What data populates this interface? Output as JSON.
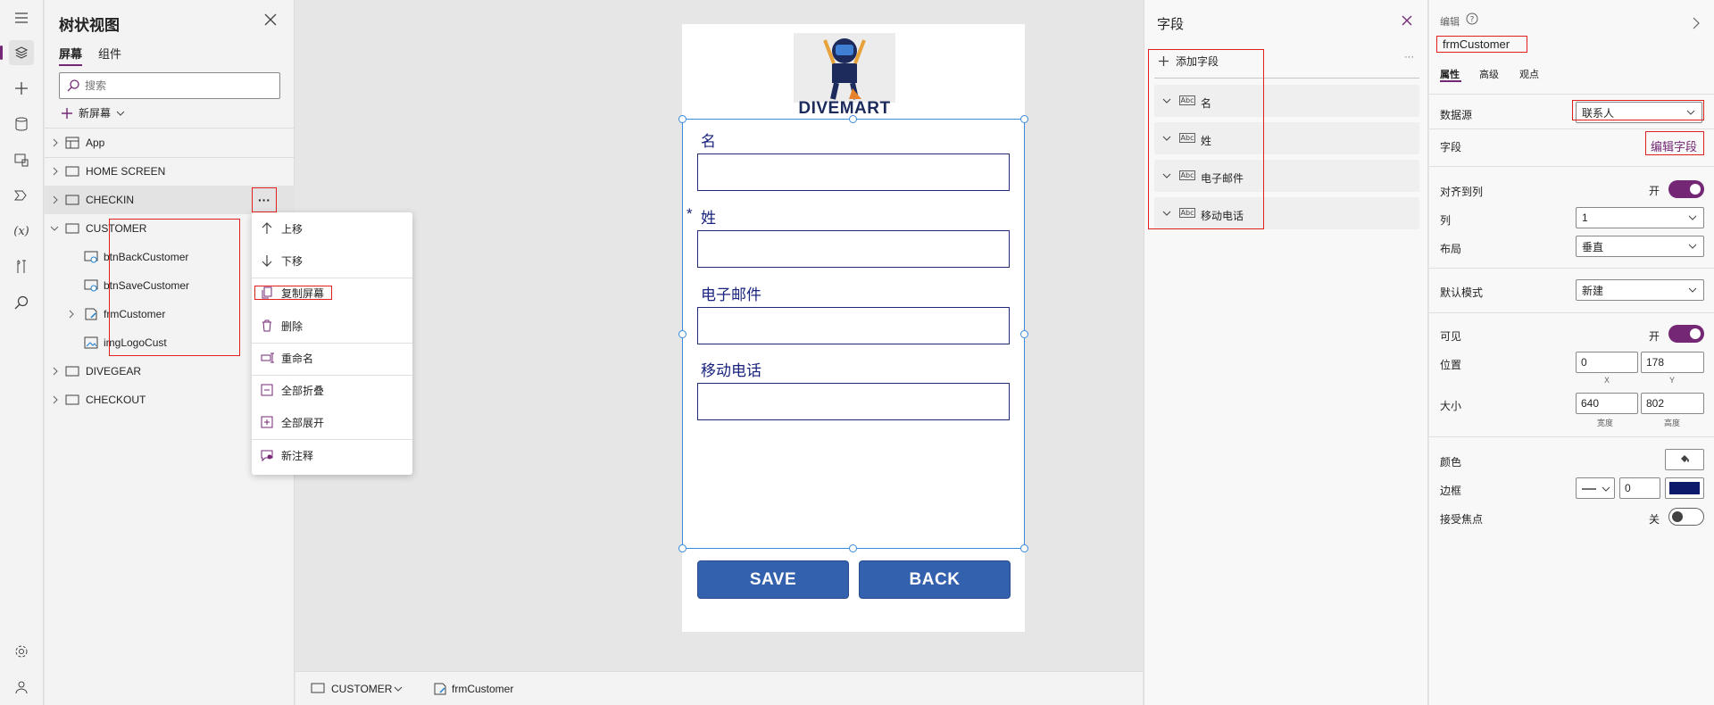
{
  "rail": {
    "icons": [
      "hamburger-icon",
      "layers-icon",
      "plus-icon",
      "database-icon",
      "media-icon",
      "power-automate-icon",
      "variables-icon",
      "tools-icon",
      "search-icon",
      "settings-icon",
      "user-icon"
    ],
    "variables_glyph": "(x)"
  },
  "tree": {
    "title": "树状视图",
    "tabs": [
      "屏幕",
      "组件"
    ],
    "search_placeholder": "搜索",
    "new_screen": "新屏幕",
    "items": [
      {
        "label": "App"
      },
      {
        "label": "HOME SCREEN"
      },
      {
        "label": "CHECKIN"
      },
      {
        "label": "CUSTOMER"
      },
      {
        "label": "btnBackCustomer"
      },
      {
        "label": "btnSaveCustomer"
      },
      {
        "label": "frmCustomer"
      },
      {
        "label": "imgLogoCust"
      },
      {
        "label": "DIVEGEAR"
      },
      {
        "label": "CHECKOUT"
      }
    ],
    "more_glyph": "···"
  },
  "context_menu": {
    "items": [
      "上移",
      "下移",
      "复制屏幕",
      "删除",
      "重命名",
      "全部折叠",
      "全部展开",
      "新注释"
    ]
  },
  "canvas": {
    "logo_text": "DIVEMART",
    "fields": [
      {
        "label": "名",
        "required": false
      },
      {
        "label": "姓",
        "required": true
      },
      {
        "label": "电子邮件",
        "required": false
      },
      {
        "label": "移动电话",
        "required": false
      }
    ],
    "required_mark": "*",
    "save_label": "SAVE",
    "back_label": "BACK"
  },
  "statusbar": {
    "screen": "CUSTOMER",
    "control": "frmCustomer"
  },
  "fields_panel": {
    "title": "字段",
    "add_field": "添加字段",
    "more": "···",
    "abc": "Abc",
    "items": [
      "名",
      "姓",
      "电子邮件",
      "移动电话"
    ]
  },
  "props": {
    "header": "编辑",
    "control_name": "frmCustomer",
    "tabs": [
      "属性",
      "高级",
      "观点"
    ],
    "datasource_label": "数据源",
    "datasource_value": "联系人",
    "fields_label": "字段",
    "edit_fields": "编辑字段",
    "snap_label": "对齐到列",
    "snap_state": "开",
    "columns_label": "列",
    "columns_value": "1",
    "layout_label": "布局",
    "layout_value": "垂直",
    "default_mode_label": "默认模式",
    "default_mode_value": "新建",
    "visible_label": "可见",
    "visible_state": "开",
    "position_label": "位置",
    "pos_x": "0",
    "pos_y": "178",
    "x_sub": "X",
    "y_sub": "Y",
    "size_label": "大小",
    "width": "640",
    "height": "802",
    "width_sub": "宽度",
    "height_sub": "高度",
    "color_label": "颜色",
    "border_label": "边框",
    "border_width": "0",
    "border_color": "#0b1a6b",
    "focus_label": "接受焦点",
    "focus_state": "关"
  },
  "colors": {
    "accent": "#742774",
    "button_blue": "#3461ad",
    "label_navy": "#1a237e",
    "highlight_red": "#e0201f"
  }
}
